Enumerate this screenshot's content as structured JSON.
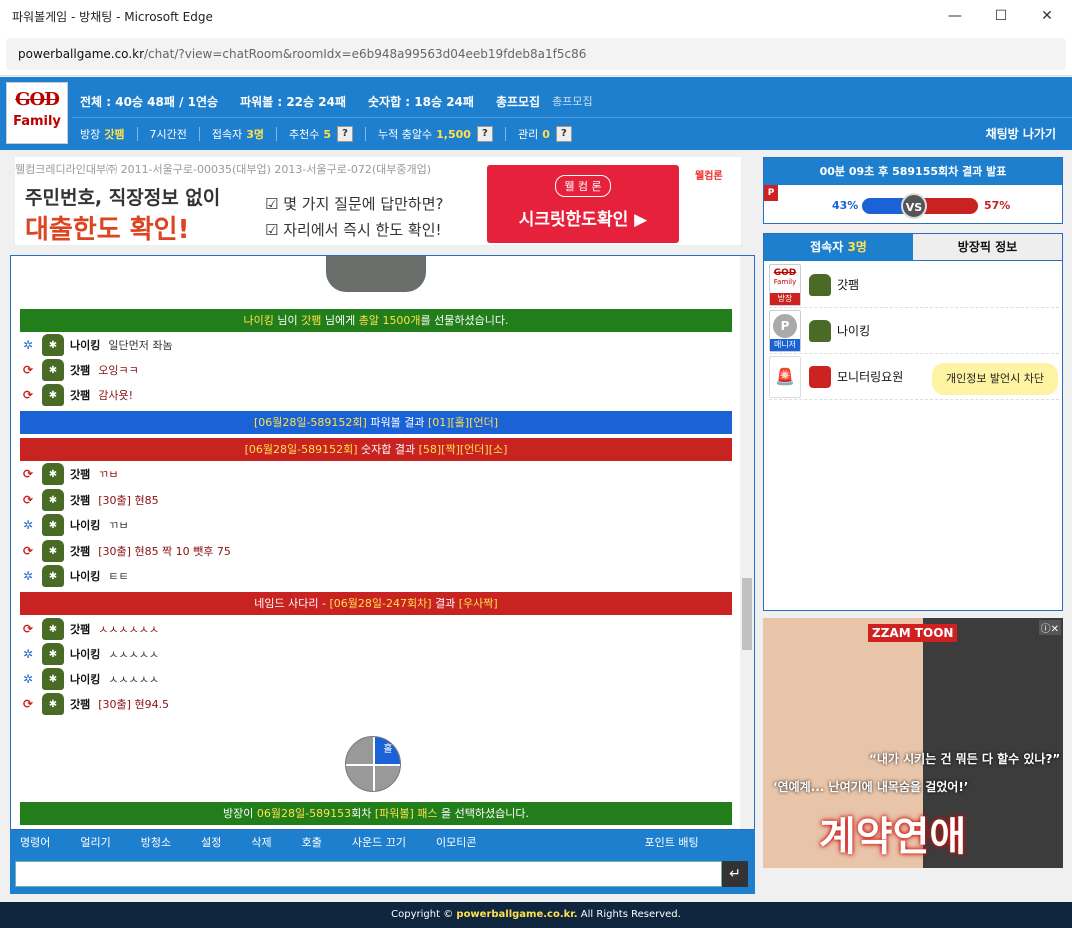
{
  "window": {
    "title": "파워볼게임 - 방채팅 - Microsoft Edge",
    "minimize": "—",
    "maximize": "☐",
    "close": "✕"
  },
  "address": {
    "host": "powerballgame.co.kr",
    "path": "/chat/?view=chatRoom&roomIdx=e6b948a99563d04eeb19fdeb8a1f5c86"
  },
  "logo": {
    "line1": "GOD",
    "line2": "Family"
  },
  "stats": {
    "total": "전체 : 40승 48패 / 1연승",
    "powerball": "파워볼 : 22승 24패",
    "numsum": "숫자합 : 18승 24패",
    "recruit": "총프모집",
    "recruit_sub": "총프모집"
  },
  "info": {
    "owner_label": "방장",
    "owner": "갓팸",
    "time": "7시간전",
    "users_label": "접속자",
    "users": "3명",
    "rec_label": "추천수",
    "rec": "5",
    "gift_label": "누적 충알수",
    "gift": "1,500",
    "manage_label": "관리",
    "manage": "0",
    "q": "?",
    "leave": "채팅방 나가기"
  },
  "ad_top": {
    "line": "웰컴크레디라인대부㈜ 2011-서울구로-00035(대부업) 2013-서울구로-072(대부중개업)",
    "m1": "주민번호, 직장정보 없이",
    "m2": "대출한도 확인!",
    "c1": "☑ 몇 가지 질문에 답만하면?",
    "c2": "☑ 자리에서 즉시 한도 확인!",
    "btn_small": "웰 컴 론",
    "btn_big": "시크릿한도확인 ▶",
    "logo": "웰컴론"
  },
  "chat": {
    "b1": {
      "pre": "나이킹",
      "mid1": " 님이 ",
      "who": "갓팸",
      "mid2": " 님에게 ",
      "amt": "총알 1500개",
      "post": "를 선물하셨습니다."
    },
    "m1": {
      "nm": "나이킹",
      "tx": "일단먼저 좌놈"
    },
    "m2": {
      "nm": "갓팸",
      "tx": "오잉ㅋㅋ"
    },
    "m3": {
      "nm": "갓팸",
      "tx": "감사욧!"
    },
    "b2": {
      "a": "[06월28일-589152회]",
      "b": " 파워볼 결과 ",
      "c": "[01][홀][언더]"
    },
    "b3": {
      "a": "[06월28일-589152회]",
      "b": " 숫자합 결과 ",
      "c": "[58][짝][언더][소]"
    },
    "m4": {
      "nm": "갓팸",
      "tx": "ㄲㅂ"
    },
    "m5": {
      "nm": "갓팸",
      "tx": "[30출] 현85"
    },
    "m6": {
      "nm": "나이킹",
      "tx": "ㄲㅂ"
    },
    "m7": {
      "nm": "갓팸",
      "tx": "[30출] 현85  짝 10 뺏후 75"
    },
    "m8": {
      "nm": "나이킹",
      "tx": "ㅌㅌ"
    },
    "b4": {
      "a": "네임드 사다리 - ",
      "b": "[06월28일-247회차]",
      "c": " 결과 ",
      "d": "[우사짝]"
    },
    "m9": {
      "nm": "갓팸",
      "tx": "ㅅㅅㅅㅅㅅㅅ"
    },
    "m10": {
      "nm": "나이킹",
      "tx": "ㅅㅅㅅㅅㅅ"
    },
    "m11": {
      "nm": "나이킹",
      "tx": "ㅅㅅㅅㅅㅅ"
    },
    "m12": {
      "nm": "갓팸",
      "tx": "[30출] 현94.5"
    },
    "pie_label": "홀",
    "b5": {
      "a": "방장이 ",
      "b": "06월28일-589153",
      "c": "회차 ",
      "d": "[파워볼] 패스",
      "e": " 을 선택하셨습니다."
    }
  },
  "menu": [
    "명령어",
    "얼리기",
    "방청소",
    "설정",
    "삭제",
    "호출",
    "사운드 끄기",
    "이모티콘",
    "포인트 배팅"
  ],
  "send": "↵",
  "result": {
    "title": "00분 09초 후 589155회차 결과 발표",
    "p": "P",
    "left": "43%",
    "right": "57%",
    "vs": "VS",
    "left_value": 43,
    "right_value": 57,
    "left_color": "#1a62d6",
    "right_color": "#c82221"
  },
  "users": {
    "tab1": "접속자 ",
    "tab1_count": "3명",
    "tab2": "방장픽 정보",
    "list": [
      {
        "badge_top": "GOD",
        "badge_sub": "Family",
        "badge_label": "방장",
        "name": "갓팸"
      },
      {
        "badge_top": "P",
        "badge_label": "매니저",
        "name": "나이킹"
      },
      {
        "badge_top": "🚨",
        "name": "모니터링요원",
        "tip": "개인정보 발언시 차단"
      }
    ]
  },
  "ad_side": {
    "brand": "ZZAM TOON",
    "q1": "“내가 시키는 건 뭐든 다 할수 있나?”",
    "q2": "‘연예계... 난여기에 내목숨을 걸었어!’",
    "big": "계약연애",
    "close": "ⓘ✕"
  },
  "footer": {
    "pre": "Copyright © ",
    "site": "powerballgame.co.kr.",
    "post": " All Rights Reserved."
  }
}
